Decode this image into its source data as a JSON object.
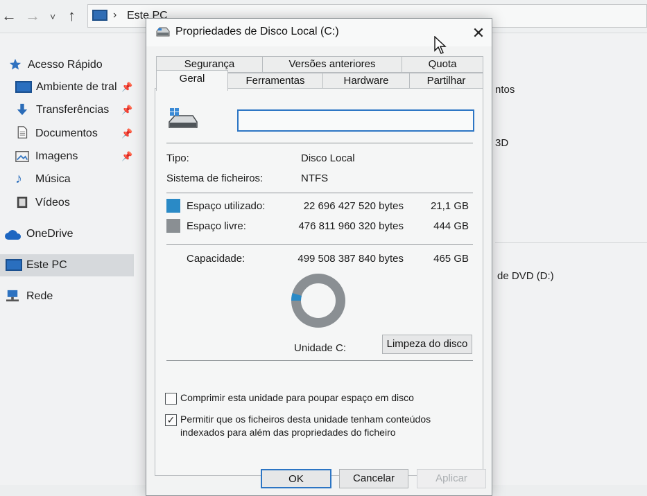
{
  "explorer": {
    "address_text": "Este PC",
    "sidebar": [
      {
        "label": "Acesso Rápido",
        "icon": "star-icon",
        "pinned": false
      },
      {
        "label": "Ambiente de tral",
        "icon": "desktop-icon",
        "pinned": true
      },
      {
        "label": "Transferências",
        "icon": "download-icon",
        "pinned": true
      },
      {
        "label": "Documentos",
        "icon": "document-icon",
        "pinned": true
      },
      {
        "label": "Imagens",
        "icon": "image-icon",
        "pinned": true
      },
      {
        "label": "Música",
        "icon": "music-icon",
        "pinned": false
      },
      {
        "label": "Vídeos",
        "icon": "video-icon",
        "pinned": false
      },
      {
        "label": "OneDrive",
        "icon": "cloud-icon",
        "pinned": false
      },
      {
        "label": "Este PC",
        "icon": "computer-icon",
        "pinned": false
      },
      {
        "label": "Rede",
        "icon": "network-icon",
        "pinned": false
      }
    ],
    "content_fragments": [
      "ntos",
      "3D",
      "de DVD (D:)"
    ]
  },
  "dialog": {
    "title": "Propriedades de Disco Local (C:)",
    "tabs_back": [
      "Segurança",
      "Versões anteriores",
      "Quota"
    ],
    "tabs_front": [
      "Geral",
      "Ferramentas",
      "Hardware",
      "Partilhar"
    ],
    "active_tab": "Geral",
    "name_value": "",
    "type_label": "Tipo:",
    "type_value": "Disco Local",
    "fs_label": "Sistema de ficheiros:",
    "fs_value": "NTFS",
    "used_label": "Espaço utilizado:",
    "used_bytes": "22 696 427 520 bytes",
    "used_size": "21,1 GB",
    "free_label": "Espaço livre:",
    "free_bytes": "476 811 960 320 bytes",
    "free_size": "444 GB",
    "capacity_label": "Capacidade:",
    "capacity_bytes": "499 508 387 840 bytes",
    "capacity_size": "465 GB",
    "drive_label": "Unidade C:",
    "cleanup_button": "Limpeza do disco",
    "compress_label": "Comprimir esta unidade para poupar espaço em disco",
    "compress_checked": false,
    "index_label_line1": "Permitir que os ficheiros desta unidade tenham conteúdos",
    "index_label_line2": "indexados para além das propriedades do ficheiro",
    "index_checked": true,
    "ok_button": "OK",
    "cancel_button": "Cancelar",
    "apply_button": "Aplicar",
    "used_fraction": 0.0454,
    "colors": {
      "used": "#2a8ac6",
      "free": "#8a8f93",
      "accent": "#2c75c4"
    }
  }
}
